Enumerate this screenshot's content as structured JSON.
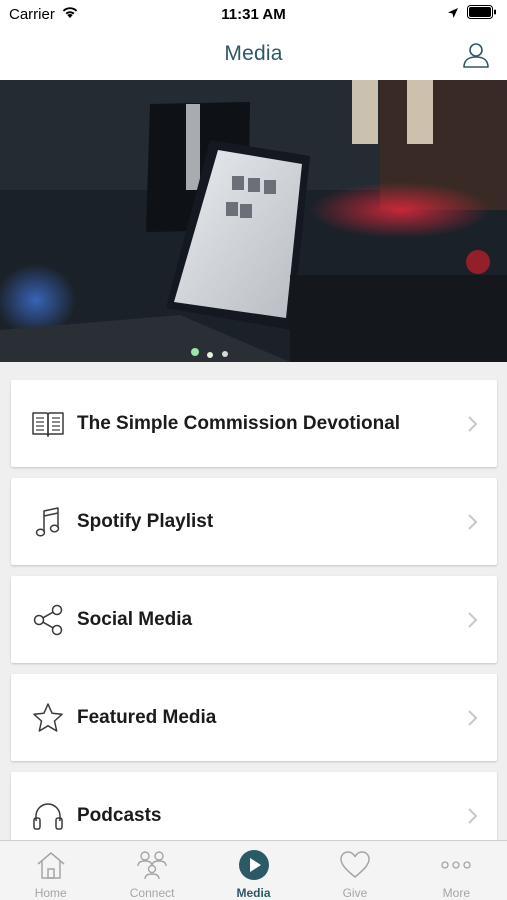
{
  "status_bar": {
    "carrier": "Carrier",
    "time": "11:31 AM"
  },
  "nav": {
    "title": "Media"
  },
  "menu": {
    "items": [
      {
        "label": "The Simple Commission Devotional",
        "icon": "book-icon"
      },
      {
        "label": "Spotify Playlist",
        "icon": "music-note-icon"
      },
      {
        "label": "Social Media",
        "icon": "share-icon"
      },
      {
        "label": "Featured Media",
        "icon": "star-icon"
      },
      {
        "label": "Podcasts",
        "icon": "headphones-icon"
      }
    ]
  },
  "tabs": [
    {
      "label": "Home",
      "icon": "home-icon"
    },
    {
      "label": "Connect",
      "icon": "people-icon"
    },
    {
      "label": "Media",
      "icon": "play-icon",
      "active": true
    },
    {
      "label": "Give",
      "icon": "heart-icon"
    },
    {
      "label": "More",
      "icon": "more-icon"
    }
  ],
  "colors": {
    "accent": "#2b5966",
    "tab_inactive": "#a5a5a8",
    "background": "#efeff0"
  }
}
